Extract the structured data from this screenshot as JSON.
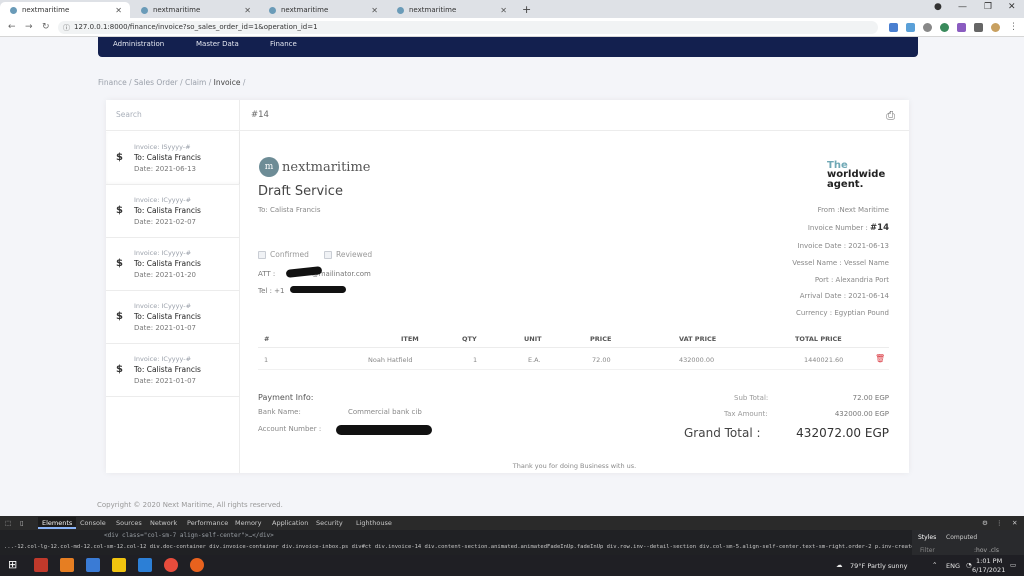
{
  "browser": {
    "tabs": [
      {
        "label": "nextmaritime",
        "active": true
      },
      {
        "label": "nextmaritime",
        "active": false
      },
      {
        "label": "nextmaritime",
        "active": false
      },
      {
        "label": "nextmaritime",
        "active": false
      }
    ],
    "new_tab": "+",
    "url": "127.0.0.1:8000/finance/invoice?so_sales_order_id=1&operation_id=1"
  },
  "nav": {
    "items": [
      "Administration",
      "Master Data",
      "Finance"
    ]
  },
  "breadcrumb": {
    "items": [
      "Finance",
      "Sales Order",
      "Claim",
      "Invoice"
    ],
    "separator": "/"
  },
  "sidebar": {
    "search_placeholder": "Search",
    "invoices": [
      {
        "meta": "Invoice: ISyyyy-#",
        "to": "To: Calista Francis",
        "date": "Date: 2021-06-13"
      },
      {
        "meta": "Invoice: ICyyyy-#",
        "to": "To: Calista Francis",
        "date": "Date: 2021-02-07"
      },
      {
        "meta": "Invoice: ICyyyy-#",
        "to": "To: Calista Francis",
        "date": "Date: 2021-01-20"
      },
      {
        "meta": "Invoice: ICyyyy-#",
        "to": "To: Calista Francis",
        "date": "Date: 2021-01-07"
      },
      {
        "meta": "Invoice: ICyyyy-#",
        "to": "To: Calista Francis",
        "date": "Date: 2021-01-07"
      }
    ]
  },
  "invoice": {
    "header_number": "#14",
    "logo_text": "nextmaritime",
    "logo_mark": "m",
    "badge": [
      "The",
      "worldwide",
      "agent."
    ],
    "title": "Draft Service",
    "to": "To: Calista Francis",
    "from": "From :Next Maritime",
    "number_label": "Invoice Number :",
    "number": "#14",
    "date": "Invoice Date : 2021-06-13",
    "vessel": "Vessel Name : Vessel Name",
    "port": "Port : Alexandria Port",
    "arrival": "Arrival Date : 2021-06-14",
    "currency": "Currency : Egyptian Pound",
    "confirmed_label": "Confirmed",
    "reviewed_label": "Reviewed",
    "att_label": "ATT :",
    "att_suffix": "@mailinator.com",
    "tel_label": "Tel : +1",
    "table": {
      "headers": [
        "#",
        "ITEM",
        "QTY",
        "UNIT",
        "PRICE",
        "VAT PRICE",
        "TOTAL PRICE"
      ],
      "rows": [
        {
          "num": "1",
          "item": "Noah Hatfield",
          "qty": "1",
          "unit": "E.A.",
          "price": "72.00",
          "vat": "432000.00",
          "total": "1440021.60"
        }
      ]
    },
    "payment": {
      "title": "Payment Info:",
      "bank_label": "Bank Name:",
      "bank_value": "Commercial bank cib",
      "account_label": "Account Number :"
    },
    "totals": {
      "subtotal_label": "Sub Total:",
      "subtotal": "72.00 EGP",
      "tax_label": "Tax Amount:",
      "tax": "432000.00 EGP",
      "grand_label": "Grand Total :",
      "grand": "432072.00 EGP"
    },
    "thanks": "Thank you for doing Business with us."
  },
  "footer": {
    "copyright": "Copyright © 2020 Next Maritime, All rights reserved."
  },
  "devtools": {
    "tabs": [
      "Elements",
      "Console",
      "Sources",
      "Network",
      "Performance",
      "Memory",
      "Application",
      "Security",
      "Lighthouse"
    ],
    "code": "<div class=\"col-sm-7 align-self-center\">…</div>",
    "crumbs": "...-12.col-lg-12.col-md-12.col-sm-12.col-12   div.doc-container   div.invoice-container   div.invoice-inbox.ps   div#ct   div.invoice-14   div.content-section.animated.animatedFadeInUp.fadeInUp   div.row.inv--detail-section   div.col-sm-5.align-self-center.text-sm-right.order-2   p.inv-created-date   span.inv-date",
    "side_tabs": [
      "Styles",
      "Computed"
    ],
    "filter": "Filter",
    "hov": ":hov .cls"
  },
  "taskbar": {
    "weather": "79°F  Partly sunny",
    "lang": "ENG",
    "time": "1:01 PM",
    "date": "6/17/2021"
  }
}
